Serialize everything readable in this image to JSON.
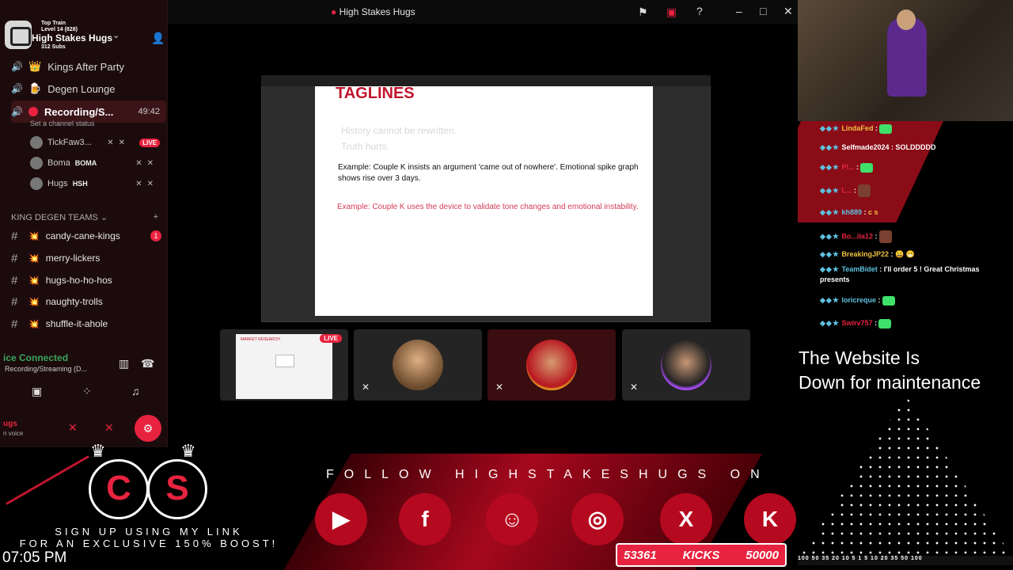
{
  "window": {
    "title": "High Stakes Hugs"
  },
  "server": {
    "name": "High Stakes Hugs",
    "overlay_lines": [
      "Top Train",
      "Level 14 (828)",
      "312 Subs"
    ],
    "voice_channels": [
      {
        "label": "Kings After Party"
      },
      {
        "label": "Degen Lounge"
      },
      {
        "label": "Recording/S...",
        "timer": "49:42",
        "status": "Set a channel status"
      }
    ],
    "users": [
      {
        "name": "TickFaw3...",
        "badge": "LIVE"
      },
      {
        "name": "Boma",
        "tag": "BOMA"
      },
      {
        "name": "Hugs",
        "tag": "HSH"
      }
    ],
    "category": "KING DEGEN TEAMS",
    "text_channels": [
      {
        "label": "candy-cane-kings",
        "unread": "1"
      },
      {
        "label": "merry-lickers"
      },
      {
        "label": "hugs-ho-ho-hos"
      },
      {
        "label": "naughty-trolls"
      },
      {
        "label": "shuffle-it-ahole"
      }
    ],
    "voice_connected": "ice Connected",
    "voice_sub": "Recording/Streaming (D...",
    "user_name": "ugs",
    "user_status": "n voice"
  },
  "slide": {
    "title": "TAGLINES",
    "ghost_lines": [
      "History cannot be rewritten.",
      "Truth hurts."
    ],
    "example1": "Example: Couple K insists an argument 'came out of nowhere'. Emotional spike graph shows rise over 3 days.",
    "example2": "Example: Couple K uses the device to validate tone changes and emotional instability."
  },
  "tiles": {
    "live": "LIVE",
    "doc_title": "MARKET RESEARCH"
  },
  "chat": [
    {
      "user": "LindaFed",
      "text": ""
    },
    {
      "user": "Selfmade2024",
      "text": "SOLDDDDD"
    },
    {
      "user": "Pl...",
      "text": ""
    },
    {
      "user": "L...",
      "text": ""
    },
    {
      "user": "kh889",
      "text": "c s"
    },
    {
      "user": "Bo...ila12",
      "text": ""
    },
    {
      "user": "BreakingJP22",
      "text": "😀 😁"
    },
    {
      "user": "TeamBidet",
      "text": "I'll order 5 ! Great Christmas presents"
    },
    {
      "user": "loricreque",
      "text": ""
    },
    {
      "user": "Swirv757",
      "text": ""
    }
  ],
  "website_notice": "The Website Is\nDown for maintenance",
  "bottom": {
    "signup": "SIGN UP USING MY LINK\nFOR AN EXCLUSIVE 150% BOOST!",
    "clock": "07:05 PM",
    "follow": "FOLLOW HIGHSTAKESHUGS ON",
    "counter_left": "53361",
    "counter_mid": "KICKS",
    "counter_right": "50000",
    "ticker": "100 50 35 20 10 5 1 5 10 20 35 50 100"
  },
  "colors": {
    "accent": "#e8233f",
    "slide_red": "#c0152d",
    "panel": "#1c0b0d"
  }
}
